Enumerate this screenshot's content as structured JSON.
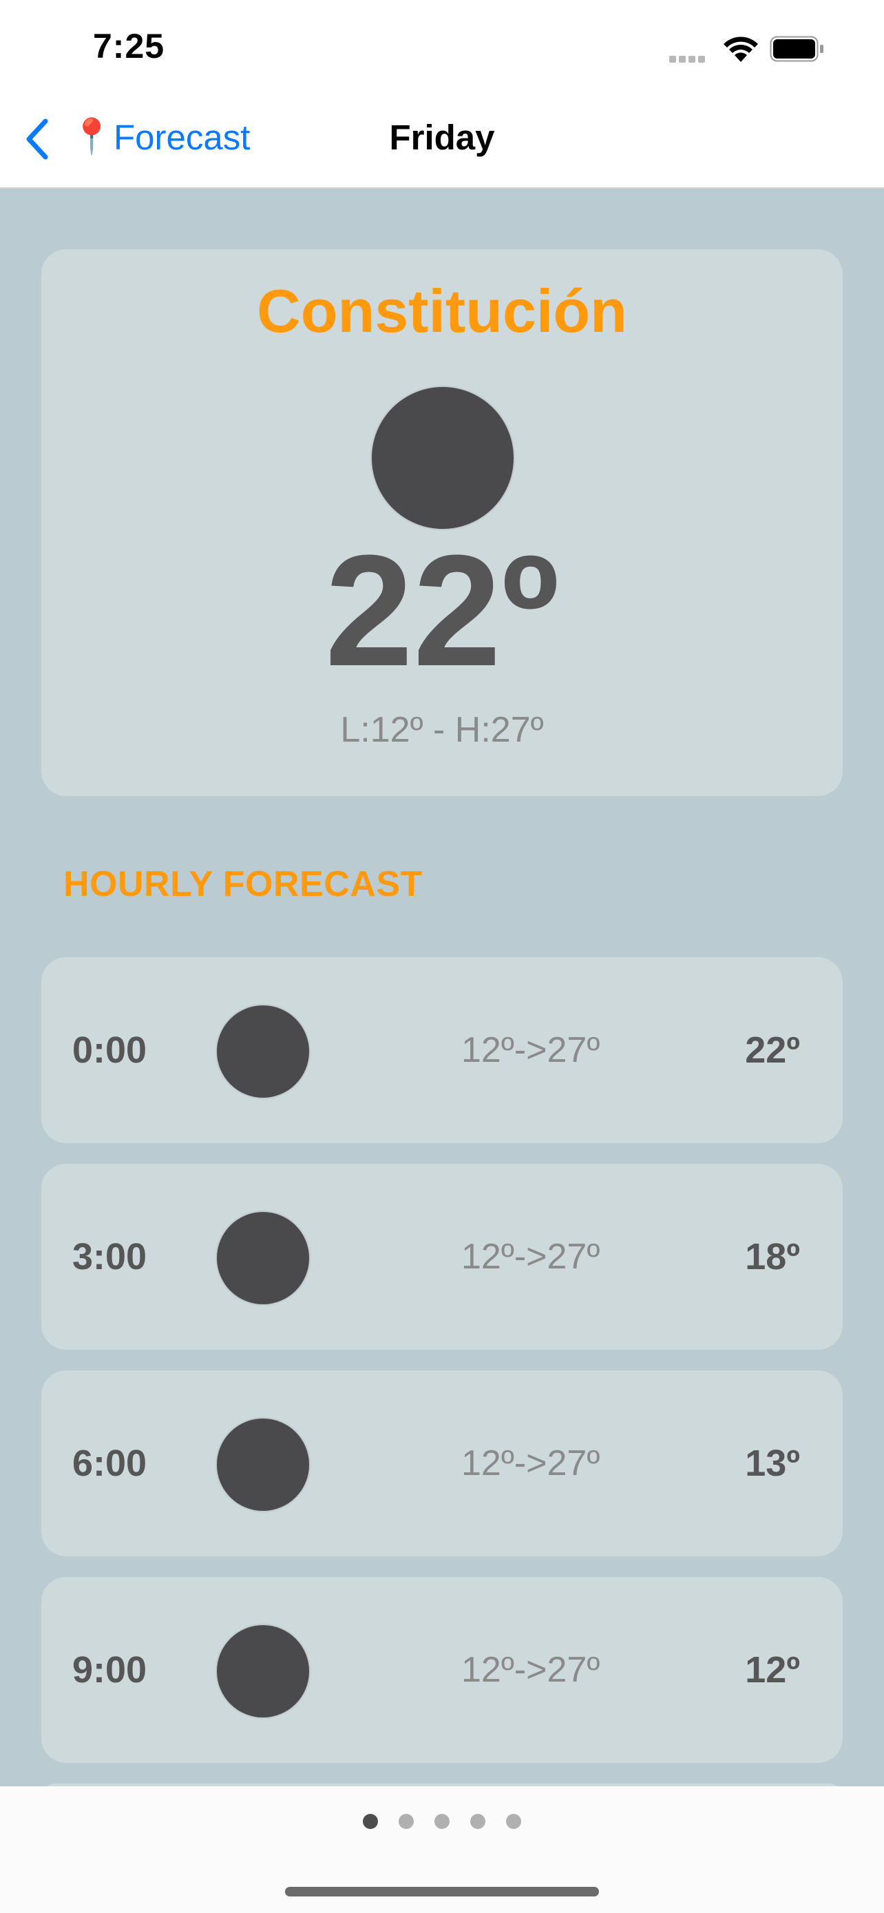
{
  "status_bar": {
    "time": "7:25"
  },
  "nav": {
    "back_pin": "📍",
    "back_label": "Forecast",
    "title": "Friday"
  },
  "current": {
    "city": "Constitución",
    "temperature": "22º",
    "range": "L:12º - H:27º"
  },
  "hourly": {
    "title": "HOURLY FORECAST",
    "rows": [
      {
        "time": "0:00",
        "range": "12º->27º",
        "temp": "22º"
      },
      {
        "time": "3:00",
        "range": "12º->27º",
        "temp": "18º"
      },
      {
        "time": "6:00",
        "range": "12º->27º",
        "temp": "13º"
      },
      {
        "time": "9:00",
        "range": "12º->27º",
        "temp": "12º"
      }
    ]
  },
  "pager": {
    "count": 5,
    "active": 1
  },
  "colors": {
    "accent": "#ff9a0e",
    "link": "#0a7aff",
    "background": "#baccd2",
    "card": "#ced9dc"
  }
}
